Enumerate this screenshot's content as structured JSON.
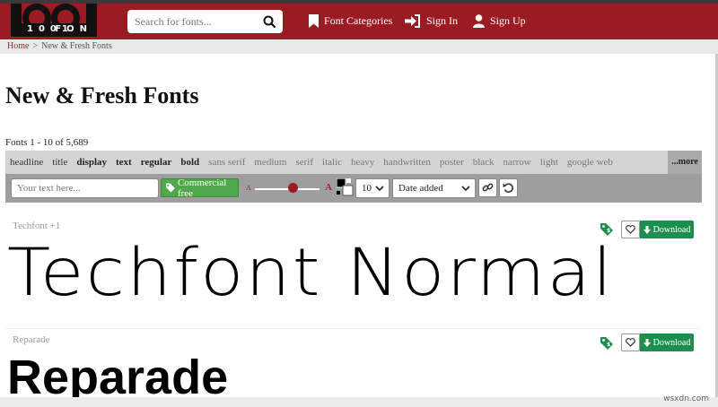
{
  "header": {
    "logo_text": "1001 FONTS",
    "search_placeholder": "Search for fonts...",
    "nav": {
      "categories": "Font Categories",
      "signin": "Sign In",
      "signup": "Sign Up"
    }
  },
  "breadcrumb": {
    "home": "Home",
    "separator": ">",
    "current": "New & Fresh Fonts"
  },
  "page": {
    "title": "New & Fresh Fonts",
    "count": "Fonts 1 - 10 of 5,689"
  },
  "filters": [
    {
      "label": "headline",
      "style": "dark"
    },
    {
      "label": "title",
      "style": "dark"
    },
    {
      "label": "display",
      "style": "bold"
    },
    {
      "label": "text",
      "style": "bold"
    },
    {
      "label": "regular",
      "style": "bold"
    },
    {
      "label": "bold",
      "style": "bold"
    },
    {
      "label": "sans serif",
      "style": "light"
    },
    {
      "label": "medium",
      "style": "light"
    },
    {
      "label": "serif",
      "style": "light"
    },
    {
      "label": "italic",
      "style": "light"
    },
    {
      "label": "heavy",
      "style": "light"
    },
    {
      "label": "handwritten",
      "style": "light"
    },
    {
      "label": "poster",
      "style": "light"
    },
    {
      "label": "black",
      "style": "light"
    },
    {
      "label": "narrow",
      "style": "light"
    },
    {
      "label": "light",
      "style": "light"
    },
    {
      "label": "google web",
      "style": "light"
    }
  ],
  "filters_more": "...more",
  "tools": {
    "text_placeholder": "Your text here...",
    "commercial_free": "Commercial free",
    "size_small": "A",
    "size_large": "A",
    "size_value": "10",
    "sort_value": "Date added"
  },
  "fonts": [
    {
      "name": "Techfont +1",
      "preview": "Techfont Normal",
      "download": "Download"
    },
    {
      "name": "Reparade",
      "preview": "Reparade",
      "download": "Download"
    }
  ],
  "watermark": "wsxdn.com",
  "colors": {
    "brand": "#9b1b22",
    "green": "#1e8e4e",
    "commercial": "#4fa84a"
  }
}
